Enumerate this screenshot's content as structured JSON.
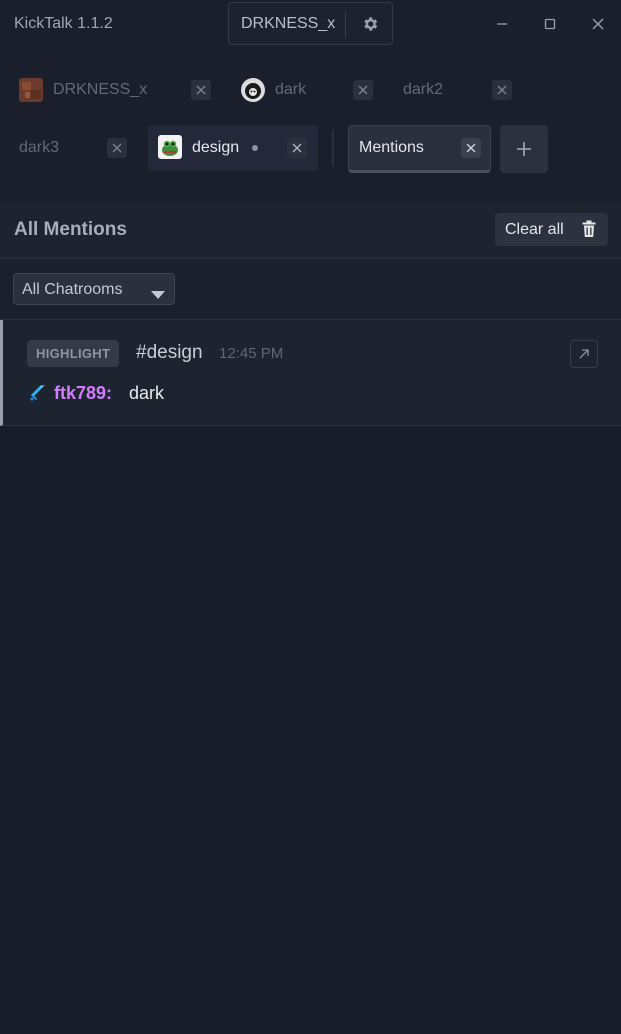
{
  "app": {
    "title": "KickTalk 1.1.2"
  },
  "user": {
    "name": "DRKNESS_x"
  },
  "tabs": [
    {
      "label": "DRKNESS_x"
    },
    {
      "label": "dark"
    },
    {
      "label": "dark2"
    },
    {
      "label": "dark3"
    },
    {
      "label": "design"
    },
    {
      "label": "Mentions"
    }
  ],
  "mentions": {
    "title": "All Mentions",
    "clear_label": "Clear all",
    "filter": {
      "selected": "All Chatrooms"
    },
    "items": [
      {
        "badge": "HIGHLIGHT",
        "channel": "#design",
        "time": "12:45 PM",
        "username": "ftk789:",
        "message": "dark",
        "username_color": "#d37bff"
      }
    ]
  },
  "colors": {
    "accent_user": "#d37bff",
    "badge_icon": "#29b6f6"
  }
}
